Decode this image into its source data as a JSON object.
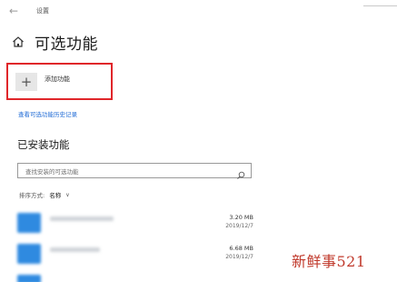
{
  "titlebar": {
    "back_glyph": "←",
    "window_title": "设置"
  },
  "header": {
    "home_icon": "home-icon",
    "title": "可选功能"
  },
  "add_feature": {
    "plus_glyph": "+",
    "label": "添加功能",
    "highlight_color": "#e0262a"
  },
  "history_link": "查看可选功能历史记录",
  "installed": {
    "section_title": "已安装功能",
    "search": {
      "placeholder": "查找安装的可选功能",
      "icon": "search-icon"
    },
    "sort": {
      "label": "排序方式:",
      "value": "名称",
      "chevron": "∨"
    },
    "items": [
      {
        "size": "3.20 MB",
        "date": "2019/12/7"
      },
      {
        "size": "6.68 MB",
        "date": "2019/12/7"
      }
    ]
  },
  "watermark": "新鲜事521",
  "colors": {
    "link": "#1f6bd6",
    "icon_tile": "#2f8ae0",
    "watermark": "#c0392b"
  }
}
